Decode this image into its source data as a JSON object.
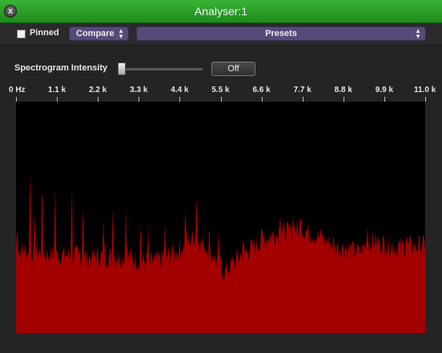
{
  "window": {
    "title": "Analyser:1",
    "close_symbol": "x"
  },
  "toolbar": {
    "pinned_label": "Pinned",
    "pinned_checked": false,
    "compare_label": "Compare",
    "presets_label": "Presets"
  },
  "controls": {
    "spectrogram_label": "Spectrogram Intensity",
    "spectrogram_intensity": 0,
    "off_label": "Off"
  },
  "colors": {
    "title_bar": "#2aa026",
    "popup": "#574a7a",
    "spectrum_fill": "#a30000",
    "plot_background": "#000000"
  },
  "chart_data": {
    "type": "area",
    "title": "",
    "xlabel": "",
    "ylabel": "",
    "tick_labels": [
      "0 Hz",
      "1.1 k",
      "2.2 k",
      "3.3 k",
      "4.4 k",
      "5.5 k",
      "6.6 k",
      "7.7 k",
      "8.8 k",
      "9.9 k",
      "11.0 k"
    ],
    "xlim_khz": [
      0,
      11.0
    ],
    "ylim": [
      0,
      1
    ],
    "baseline": 0.36,
    "noise": 0.05,
    "envelope": [
      [
        0.0,
        0.36
      ],
      [
        1.0,
        0.34
      ],
      [
        2.0,
        0.33
      ],
      [
        3.0,
        0.33
      ],
      [
        3.6,
        0.3
      ],
      [
        4.3,
        0.35
      ],
      [
        4.8,
        0.42
      ],
      [
        5.2,
        0.36
      ],
      [
        5.6,
        0.26
      ],
      [
        6.0,
        0.33
      ],
      [
        6.8,
        0.42
      ],
      [
        7.7,
        0.45
      ],
      [
        8.6,
        0.38
      ],
      [
        9.2,
        0.35
      ],
      [
        9.6,
        0.4
      ],
      [
        10.2,
        0.37
      ],
      [
        11.0,
        0.38
      ]
    ],
    "peaks": [
      [
        0.03,
        0.48
      ],
      [
        0.38,
        0.82
      ],
      [
        0.5,
        0.55
      ],
      [
        0.7,
        0.75
      ],
      [
        1.05,
        0.7
      ],
      [
        1.5,
        0.72
      ],
      [
        1.8,
        0.62
      ],
      [
        2.35,
        0.52
      ],
      [
        2.6,
        0.59
      ],
      [
        2.95,
        0.56
      ],
      [
        3.35,
        0.52
      ],
      [
        3.55,
        0.48
      ],
      [
        4.0,
        0.5
      ],
      [
        4.55,
        0.58
      ],
      [
        4.85,
        0.64
      ],
      [
        5.2,
        0.49
      ],
      [
        5.45,
        0.47
      ],
      [
        6.1,
        0.43
      ],
      [
        6.6,
        0.48
      ],
      [
        7.1,
        0.52
      ],
      [
        7.45,
        0.51
      ],
      [
        7.65,
        0.52
      ],
      [
        8.2,
        0.44
      ],
      [
        9.45,
        0.46
      ],
      [
        10.5,
        0.43
      ]
    ]
  }
}
